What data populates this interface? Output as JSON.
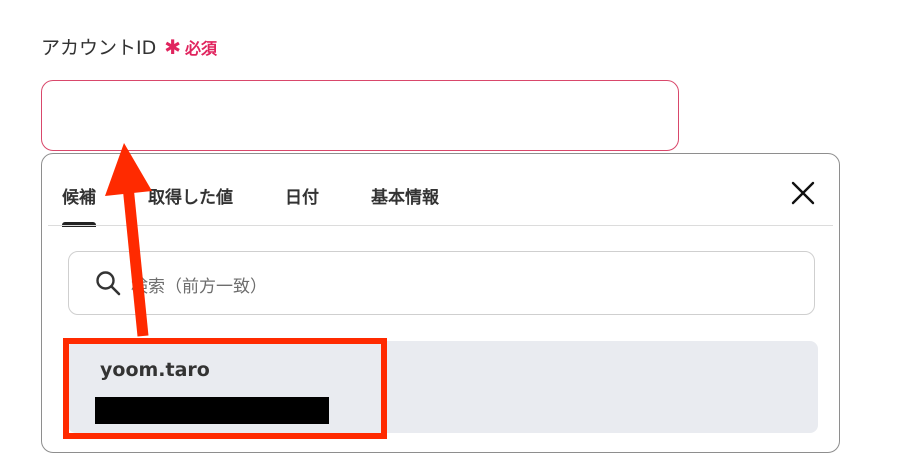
{
  "field": {
    "label": "アカウントID",
    "required_marker": "✱",
    "required_text": "必須",
    "value": ""
  },
  "dropdown": {
    "tabs": [
      {
        "label": "候補",
        "active": true
      },
      {
        "label": "取得した値",
        "active": false
      },
      {
        "label": "日付",
        "active": false
      },
      {
        "label": "基本情報",
        "active": false
      }
    ],
    "close_icon": "close-icon",
    "search": {
      "placeholder": "検索（前方一致）",
      "icon": "search-icon"
    },
    "options": [
      {
        "label": "yoom.taro",
        "sublabel_redacted": true
      }
    ]
  },
  "annotation": {
    "color": "#ff2a00"
  },
  "colors": {
    "required": "#e0245e",
    "input_border": "#d9486b",
    "option_bg": "#e9ebf0",
    "annotation": "#ff2a00"
  }
}
